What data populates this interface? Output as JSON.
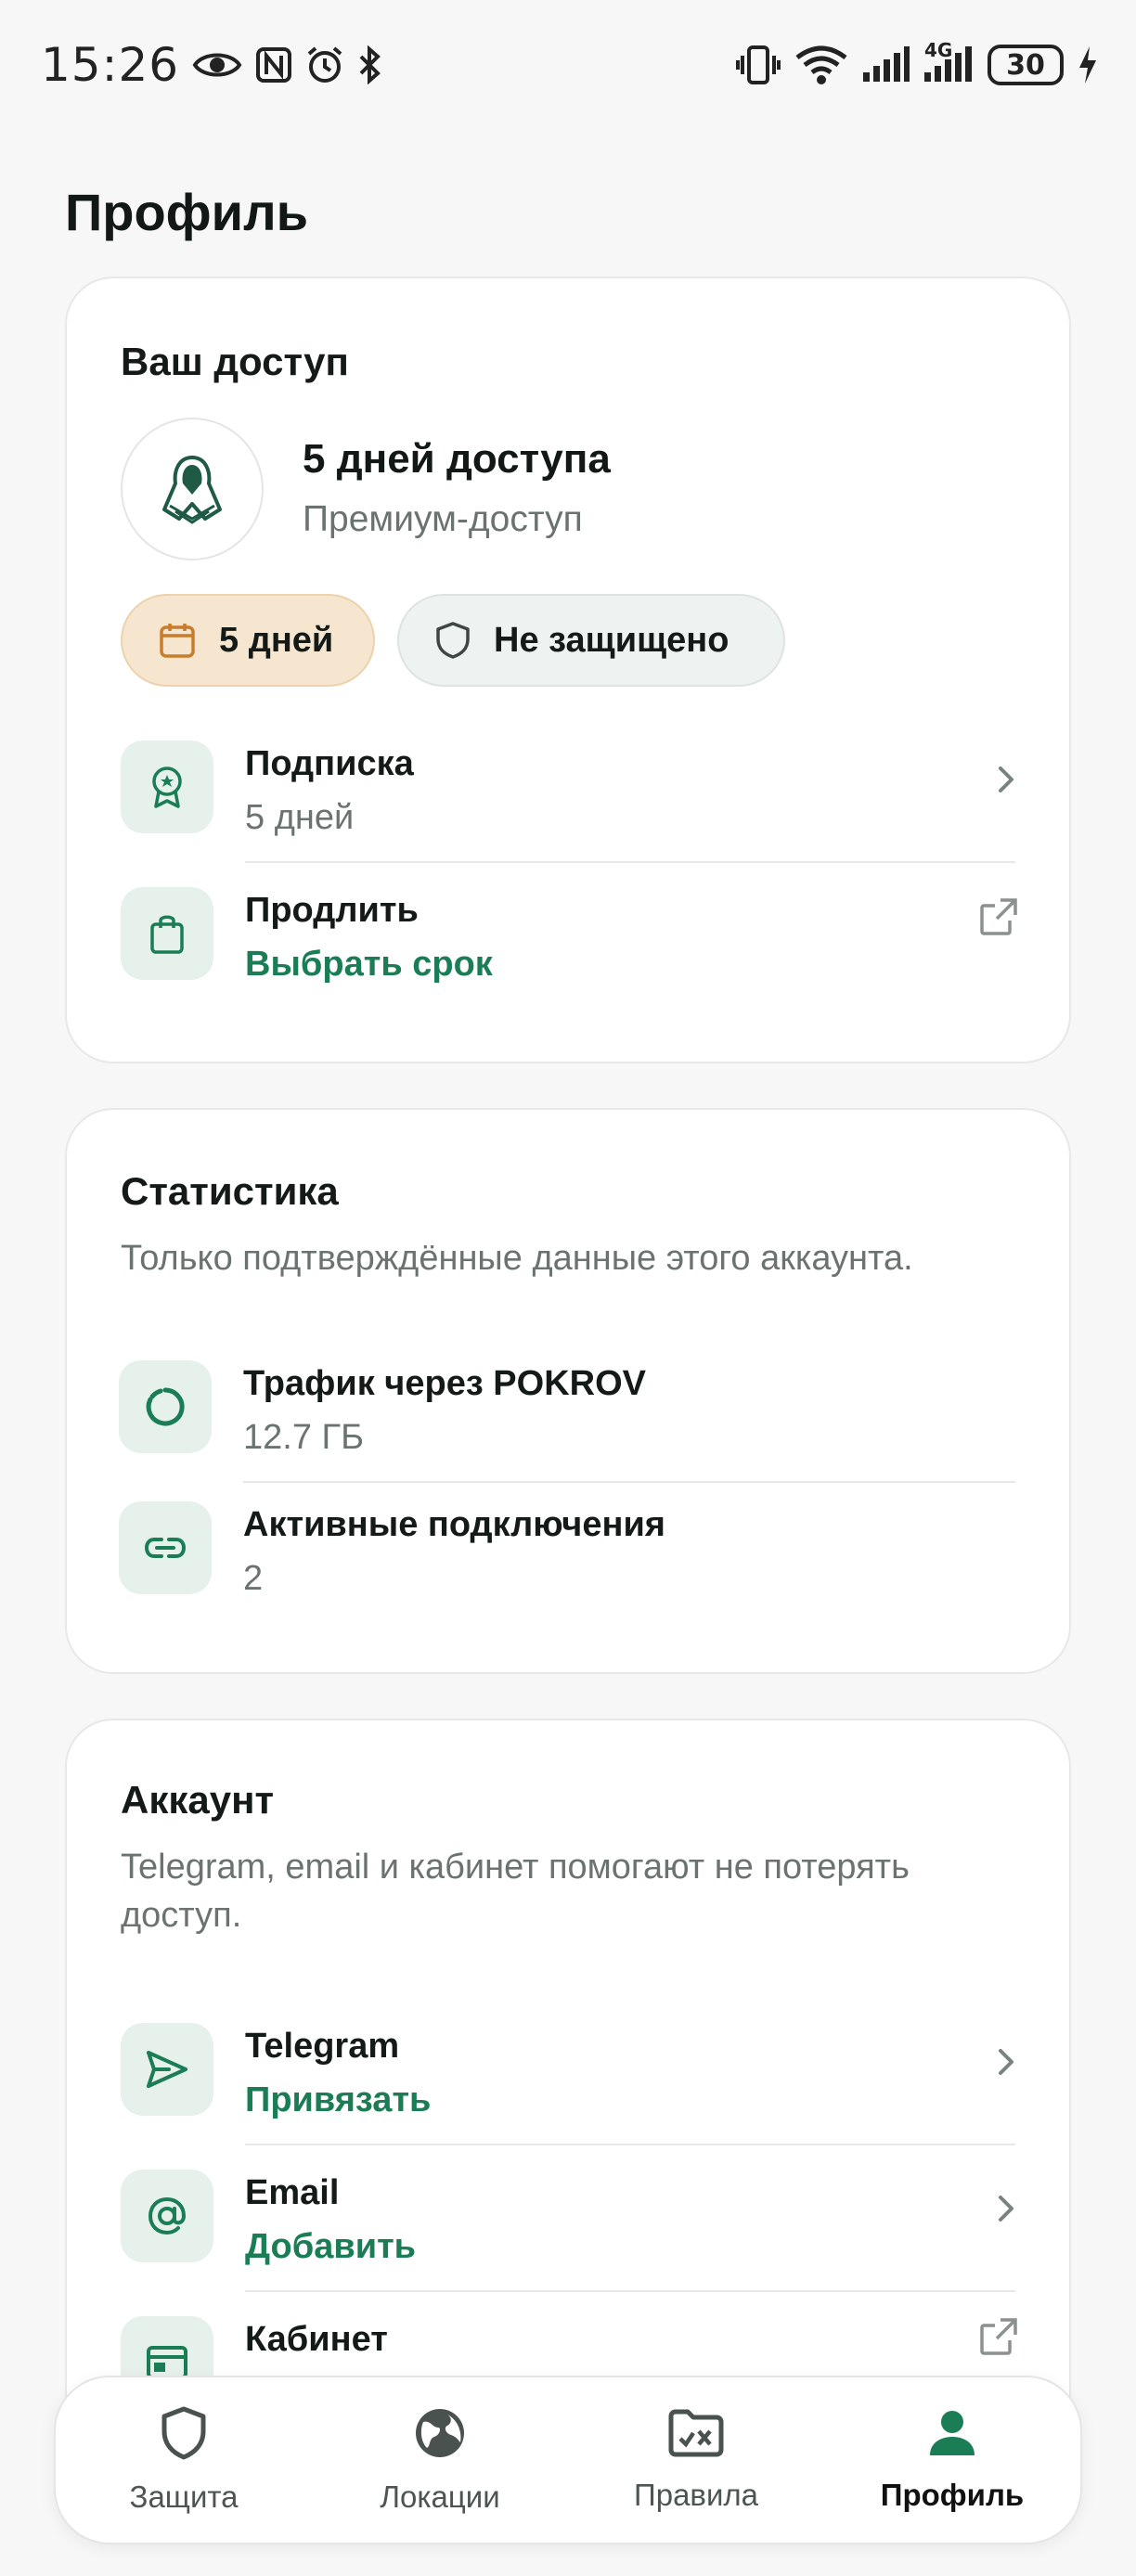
{
  "status_bar": {
    "time": "15:26",
    "network": "4G",
    "battery": "30"
  },
  "page": {
    "title": "Профиль"
  },
  "access": {
    "title": "Ваш доступ",
    "plan_title": "5 дней доступа",
    "plan_subtitle": "Премиум-доступ",
    "chip_days": "5 дней",
    "chip_protection": "Не защищено",
    "rows": [
      {
        "title": "Подписка",
        "subtitle": "5 дней",
        "icon": "award-icon",
        "trailing": "chevron-right-icon"
      },
      {
        "title": "Продлить",
        "subtitle": "Выбрать срок",
        "icon": "shopping-bag-icon",
        "trailing": "external-link-icon"
      }
    ]
  },
  "stats": {
    "title": "Статистика",
    "subtitle": "Только подтверждённые данные этого аккаунта.",
    "rows": [
      {
        "title": "Трафик через POKROV",
        "value": "12.7 ГБ",
        "icon": "progress-ring-icon"
      },
      {
        "title": "Активные подключения",
        "value": "2",
        "icon": "link-icon"
      }
    ]
  },
  "account": {
    "title": "Аккаунт",
    "subtitle_line1": "Telegram, email и кабинет помогают не потерять",
    "subtitle_line2": "доступ.",
    "rows": [
      {
        "title": "Telegram",
        "subtitle": "Привязать",
        "icon": "send-icon",
        "trailing": "chevron-right-icon"
      },
      {
        "title": "Email",
        "subtitle": "Добавить",
        "icon": "at-sign-icon",
        "trailing": "chevron-right-icon"
      },
      {
        "title": "Кабинет",
        "icon": "browser-window-icon",
        "trailing": "external-link-icon"
      }
    ]
  },
  "nav": {
    "items": [
      {
        "label": "Защита",
        "icon": "shield-icon",
        "active": false
      },
      {
        "label": "Локации",
        "icon": "globe-icon",
        "active": false
      },
      {
        "label": "Правила",
        "icon": "folder-rules-icon",
        "active": false
      },
      {
        "label": "Профиль",
        "icon": "person-icon",
        "active": true
      }
    ]
  },
  "colors": {
    "accent": "#1a7d55",
    "icon_bg": "#e6f1ec",
    "chip_warning_bg": "#f7e6cf",
    "chip_neutral_bg": "#eef2f0",
    "page_bg": "#f6f7f6"
  }
}
